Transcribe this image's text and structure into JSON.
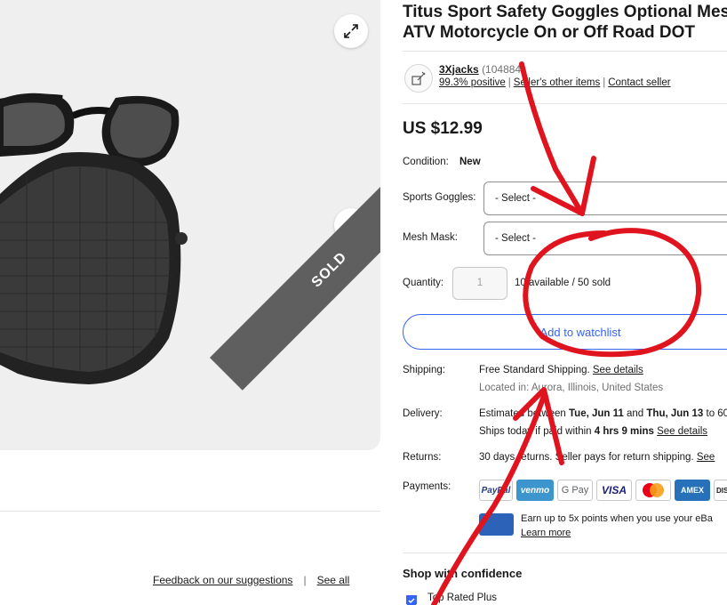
{
  "product": {
    "title_line1": "Titus Sport Safety Goggles Optional Mesh",
    "title_line2": "ATV Motorcycle On or Off Road DOT",
    "sold_banner": "SOLD"
  },
  "seller": {
    "name": "3Xjacks",
    "feedback_count": "(104884",
    "positive": "99.3% positive",
    "other_items": "Seller's other items",
    "contact": "Contact seller"
  },
  "price": "US $12.99",
  "condition": {
    "label": "Condition:",
    "value": "New"
  },
  "options": [
    {
      "label": "Sports Goggles:",
      "value": "- Select -"
    },
    {
      "label": "Mesh Mask:",
      "value": "- Select -"
    }
  ],
  "quantity": {
    "label": "Quantity:",
    "value": "1",
    "info": "10 available / 50 sold"
  },
  "watchlist_button": "Add to watchlist",
  "shipping": {
    "label": "Shipping:",
    "free": "Free",
    "method": "Standard Shipping.",
    "details_link": "See details",
    "location": "Located in: Aurora, Illinois, United States"
  },
  "delivery": {
    "label": "Delivery:",
    "estimated_prefix": "Estimated between",
    "date_start": "Tue, Jun 11",
    "and": "and",
    "date_end": "Thu, Jun 13",
    "to": "to 60",
    "ships_prefix": "Ships today if paid within",
    "time_left": "4 hrs 9 mins",
    "details_link": "See details"
  },
  "returns": {
    "label": "Returns:",
    "text": "30 days returns. Seller pays for return shipping.",
    "link": "See"
  },
  "payments": {
    "label": "Payments:",
    "methods": [
      "PayPal",
      "venmo",
      "G Pay",
      "VISA",
      "Mastercard",
      "AMEX",
      "DISCO"
    ],
    "earn_text": "Earn up to 5x points when you use your eBa",
    "learn_more": "Learn more"
  },
  "confidence": {
    "heading": "Shop with confidence",
    "top_rated": "Top Rated Plus"
  },
  "footer": {
    "feedback_link": "Feedback on our suggestions",
    "separator": "|",
    "see_all": "See all"
  },
  "colors": {
    "accent": "#3665f3",
    "annotation": "#e0141e",
    "sold_band": "#5f5f5f"
  }
}
